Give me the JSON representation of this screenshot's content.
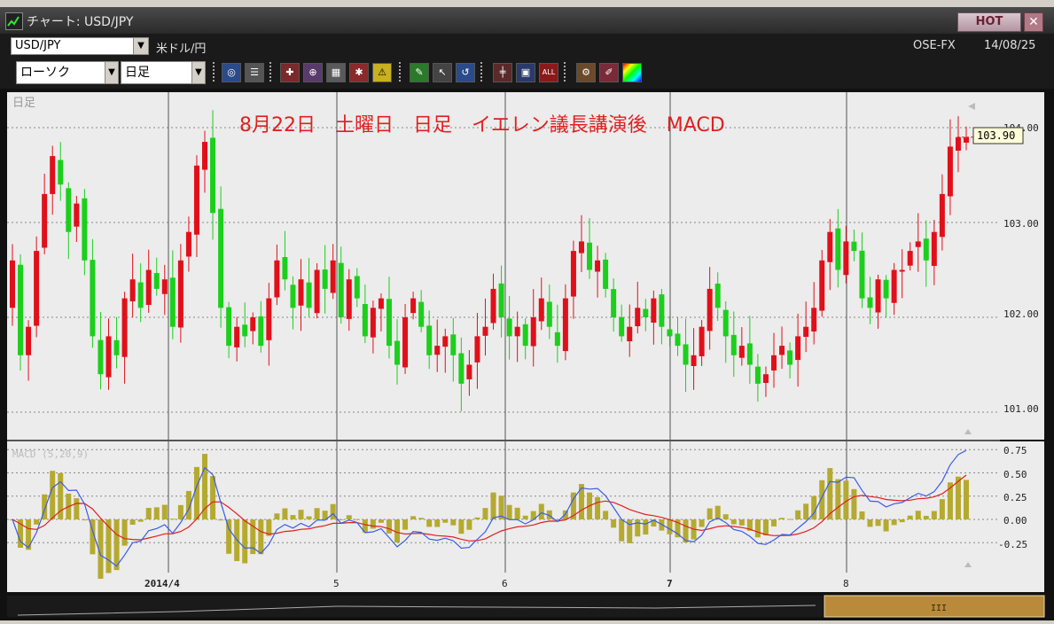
{
  "window": {
    "title": "チャート: USD/JPY",
    "hot_label": "HOT",
    "close_label": "✕"
  },
  "symbol_bar": {
    "symbol": "USD/JPY",
    "description": "米ドル/円",
    "source": "OSE-FX",
    "date": "14/08/25"
  },
  "toolbar": {
    "chart_type": "ローソク",
    "period": "日足",
    "icons": [
      "zoom-icon",
      "grid-icon",
      "cross-icon",
      "ruler-icon",
      "table-icon",
      "alert-icon",
      "warning-icon",
      "pen-icon",
      "pointer-icon",
      "undo-icon",
      "candle-icon",
      "box-icon",
      "all-icon",
      "settings-icon",
      "paint-icon",
      "palette-icon"
    ],
    "all_label": "ALL"
  },
  "chart": {
    "panel_label": "日足",
    "annotation": "8月22日　土曜日　日足　イエレン議長講演後　MACD",
    "annotation_color": "#e02020",
    "price_ticks": [
      "104.00",
      "103.00",
      "102.00",
      "101.00"
    ],
    "current_price": "103.90",
    "macd_label": "MACD (5,20,9)",
    "macd_ticks": [
      "0.75",
      "0.50",
      "0.25",
      "0.00",
      "-0.25"
    ],
    "x_labels": [
      "2014/4",
      "5",
      "6",
      "7",
      "8"
    ],
    "up_color": "#e0101a",
    "down_color": "#1ccf1c",
    "macd_line_color": "#3a5ce8",
    "signal_line_color": "#e02020",
    "hist_color": "#b5aa30",
    "bg_color": "#ececec"
  },
  "chart_data": {
    "type": "candlestick",
    "title": "8月22日　土曜日　日足　イエレン議長講演後　MACD",
    "ylim": [
      100.85,
      104.35
    ],
    "last_close": 103.9,
    "closes": [
      102.6,
      101.6,
      101.9,
      102.7,
      103.3,
      103.7,
      103.4,
      102.9,
      103.2,
      102.6,
      101.8,
      101.4,
      101.8,
      101.6,
      102.2,
      102.4,
      102.1,
      102.5,
      102.3,
      102.4,
      101.9,
      102.6,
      102.9,
      103.6,
      103.85,
      103.1,
      102.1,
      101.7,
      101.9,
      101.8,
      102.0,
      101.7,
      102.2,
      102.6,
      102.4,
      102.1,
      102.4,
      102.1,
      102.5,
      102.3,
      102.6,
      102.0,
      102.4,
      102.2,
      101.8,
      102.1,
      102.2,
      101.7,
      101.5,
      102.0,
      102.2,
      101.9,
      101.6,
      101.7,
      101.8,
      101.6,
      101.3,
      101.5,
      101.8,
      101.9,
      102.3,
      102.0,
      101.8,
      101.9,
      101.7,
      102.0,
      102.2,
      101.9,
      101.7,
      102.2,
      102.7,
      102.8,
      102.5,
      102.6,
      102.3,
      102.0,
      101.8,
      101.9,
      102.1,
      102.0,
      102.2,
      101.9,
      101.8,
      101.7,
      101.5,
      101.6,
      101.9,
      102.3,
      102.1,
      101.8,
      101.6,
      101.7,
      101.5,
      101.3,
      101.4,
      101.6,
      101.7,
      101.5,
      101.8,
      101.9,
      102.1,
      102.6,
      102.9,
      102.5,
      102.8,
      102.7,
      102.2,
      102.1,
      102.4,
      102.2,
      102.5,
      102.5,
      102.7,
      102.8,
      102.6,
      102.9,
      103.3,
      103.8,
      103.9,
      103.9
    ]
  }
}
